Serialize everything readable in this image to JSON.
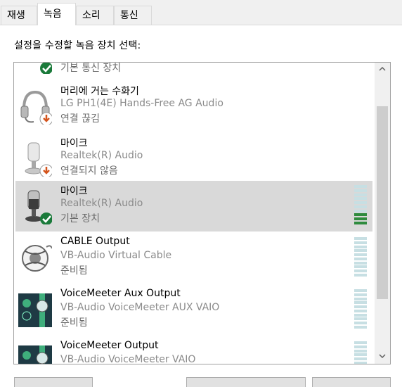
{
  "tabs": [
    {
      "label": "재생"
    },
    {
      "label": "녹음"
    },
    {
      "label": "소리"
    },
    {
      "label": "통신"
    }
  ],
  "active_tab": "녹음",
  "prompt": "설정을 수정할 녹음 장치 선택:",
  "devices": [
    {
      "name": "",
      "description": "",
      "status": "기본 통신 장치",
      "icon": "default-comm-device-icon",
      "badge": "check"
    },
    {
      "name": "머리에 거는 수화기",
      "description": "LG PH1(4E) Hands-Free AG Audio",
      "status": "연결 끊김",
      "icon": "headset-icon",
      "badge": "down-arrow"
    },
    {
      "name": "마이크",
      "description": "Realtek(R) Audio",
      "status": "연결되지 않음",
      "icon": "microphone-icon",
      "badge": "down-arrow"
    },
    {
      "name": "마이크",
      "description": "Realtek(R) Audio",
      "status": "기본 장치",
      "icon": "microphone-icon",
      "badge": "check",
      "selected": true,
      "level": 0.25
    },
    {
      "name": "CABLE Output",
      "description": "VB-Audio Virtual Cable",
      "status": "준비됨",
      "icon": "cable-icon",
      "level": 0
    },
    {
      "name": "VoiceMeeter Aux Output",
      "description": "VB-Audio VoiceMeeter AUX VAIO",
      "status": "준비됨",
      "icon": "voicemeeter-icon",
      "level": 0
    },
    {
      "name": "VoiceMeeter Output",
      "description": "VB-Audio VoiceMeeter VAIO",
      "status": "",
      "icon": "voicemeeter-icon",
      "level": 0
    }
  ],
  "colors": {
    "badge_check": "#1a7a3a",
    "badge_arrow": "#d4541c",
    "meter_empty": "#c7dfe3",
    "meter_active": "#2e8b3e",
    "selection": "#d9d9d9"
  },
  "scrollbar": {
    "up_icon": "chevron-up-icon",
    "down_icon": "chevron-down-icon"
  }
}
